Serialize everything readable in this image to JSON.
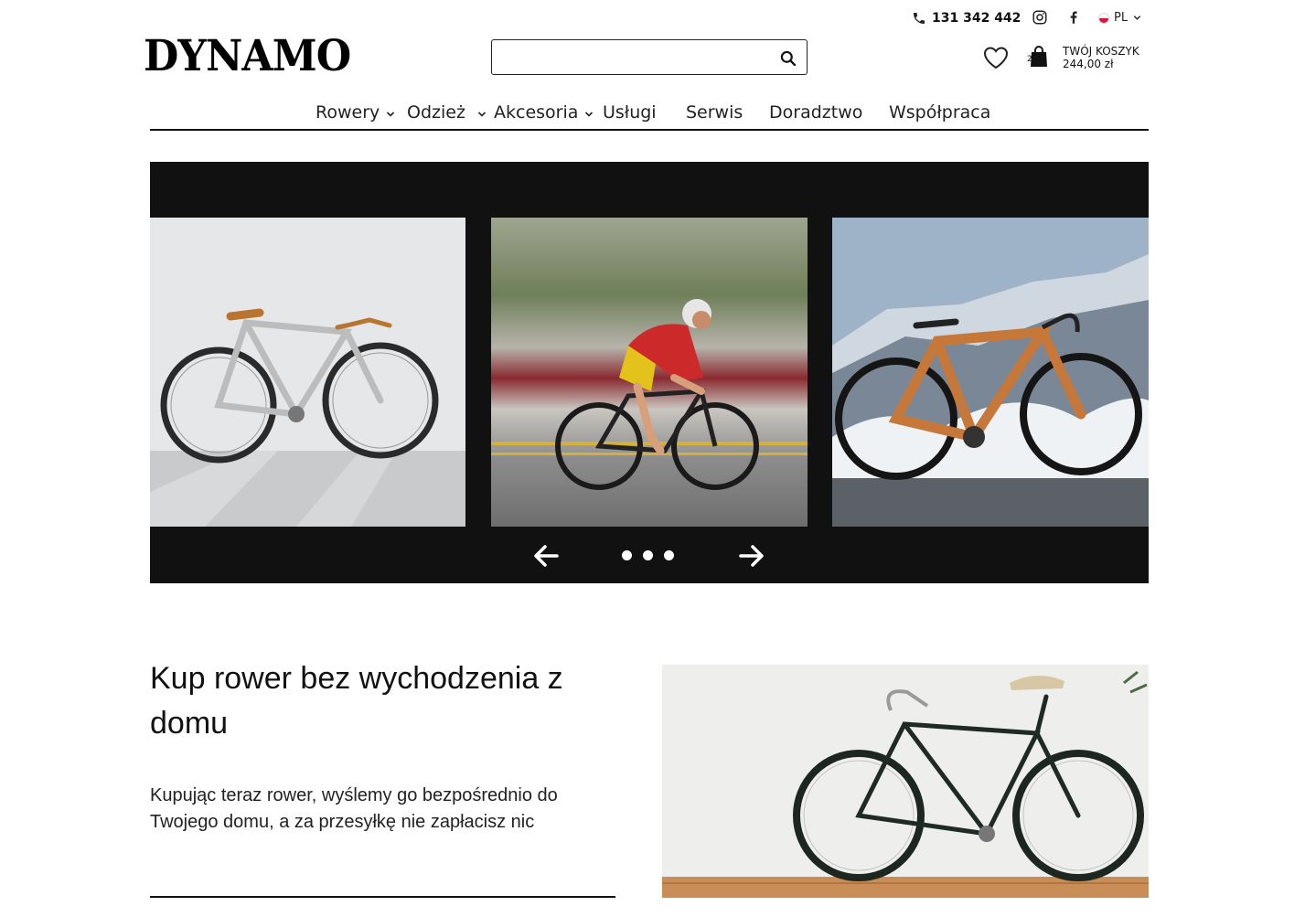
{
  "topbar": {
    "phone": "131 342 442",
    "language": "PL"
  },
  "header": {
    "logo": "DYNAMO",
    "search": {
      "placeholder": "",
      "value": ""
    },
    "cart": {
      "count": "2",
      "label": "TWÓJ KOSZYK",
      "total": "244,00 zł"
    }
  },
  "nav": {
    "items": [
      {
        "label": "Rowery",
        "has_dropdown": true
      },
      {
        "label": "Odzież",
        "has_dropdown": true
      },
      {
        "label": "Akcesoria",
        "has_dropdown": true
      },
      {
        "label": "Usługi",
        "has_dropdown": false
      },
      {
        "label": "Serwis",
        "has_dropdown": false
      },
      {
        "label": "Doradztwo",
        "has_dropdown": false
      },
      {
        "label": "Współpraca",
        "has_dropdown": false
      }
    ]
  },
  "slider": {
    "slides": 3,
    "dots": 3
  },
  "promo": {
    "title": "Kup rower bez wychodzenia z domu",
    "text": "Kupując teraz rower, wyślemy go bezpośrednio do Twojego domu, a za przesyłkę nie zapłacisz nic"
  },
  "colors": {
    "text": "#111111",
    "slider_bg": "#111111",
    "accent_orange": "#c97a3a"
  }
}
